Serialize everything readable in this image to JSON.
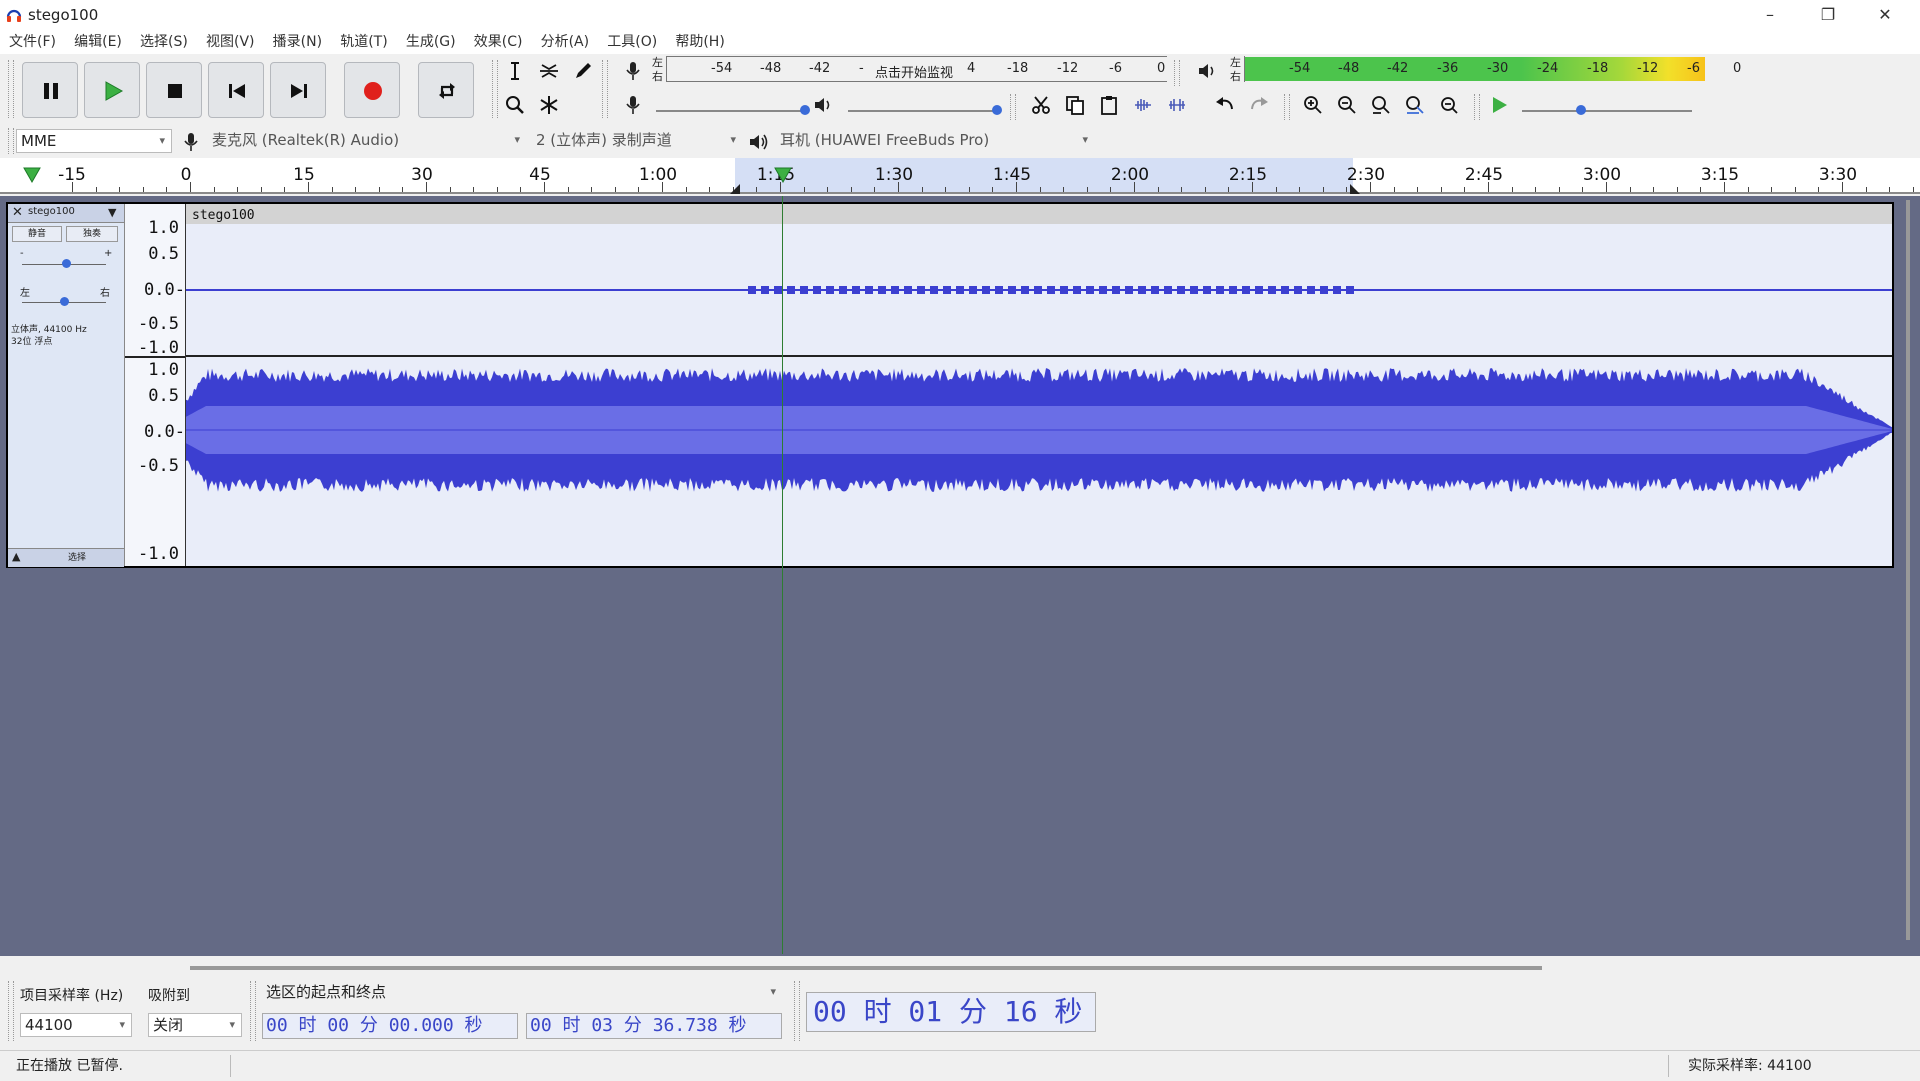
{
  "window": {
    "title": "stego100",
    "minimize": "–",
    "restore": "❐",
    "close": "✕"
  },
  "menu": [
    "文件(F)",
    "编辑(E)",
    "选择(S)",
    "视图(V)",
    "播录(N)",
    "轨道(T)",
    "生成(G)",
    "效果(C)",
    "分析(A)",
    "工具(O)",
    "帮助(H)"
  ],
  "transport": [
    "pause-icon",
    "play-icon",
    "stop-icon",
    "skip-start-icon",
    "skip-end-icon",
    "record-icon",
    "loop-icon"
  ],
  "record_meter": {
    "lr_top": "左",
    "lr_bottom": "右",
    "scale": [
      "-54",
      "-48",
      "-42",
      "-",
      "点击开始监视",
      "4",
      "-18",
      "-12",
      "-6",
      "0"
    ]
  },
  "play_meter": {
    "lr_top": "左",
    "lr_bottom": "右",
    "scale": [
      "-54",
      "-48",
      "-42",
      "-36",
      "-30",
      "-24",
      "-18",
      "-12",
      "-6",
      "0"
    ]
  },
  "device": {
    "host": "MME",
    "input": "麦克风 (Realtek(R) Audio)",
    "channels": "2 (立体声) 录制声道",
    "output": "耳机 (HUAWEI FreeBuds Pro)"
  },
  "timeline": {
    "labels": [
      "-15",
      "0",
      "15",
      "30",
      "45",
      "1:00",
      "1:15",
      "1:30",
      "1:45",
      "2:00",
      "2:15",
      "2:30",
      "2:45",
      "3:00",
      "3:15",
      "3:30"
    ]
  },
  "track": {
    "name": "stego100",
    "clip_name": "stego100",
    "mute": "静音",
    "solo": "独奏",
    "gain_minus": "-",
    "gain_plus": "+",
    "pan_left": "左",
    "pan_right": "右",
    "info_line1": "立体声, 44100 Hz",
    "info_line2": "32位 浮点",
    "select": "选择",
    "ruler_top": [
      "1.0",
      "0.5",
      "0.0-",
      "-0.5",
      "-1.0"
    ],
    "ruler_bottom": [
      "1.0",
      "0.5",
      "0.0-",
      "-0.5",
      "-1.0"
    ]
  },
  "selection_toolbar": {
    "rate_label": "项目采样率 (Hz)",
    "snap_label": "吸附到",
    "sel_mode": "选区的起点和终点",
    "rate_value": "44100",
    "snap_value": "关闭",
    "start_time": "00 时 00 分 00.000 秒",
    "end_time": "00 时 03 分 36.738 秒",
    "audio_position": "00 时 01 分 16 秒"
  },
  "status": {
    "left": "正在播放 已暂停.",
    "right": "实际采样率: 44100"
  },
  "colors": {
    "wave": "#3c3fd1",
    "wave_rms": "#6a6ee6",
    "playhead": "#2e7d32",
    "selection": "#d5dff5"
  }
}
